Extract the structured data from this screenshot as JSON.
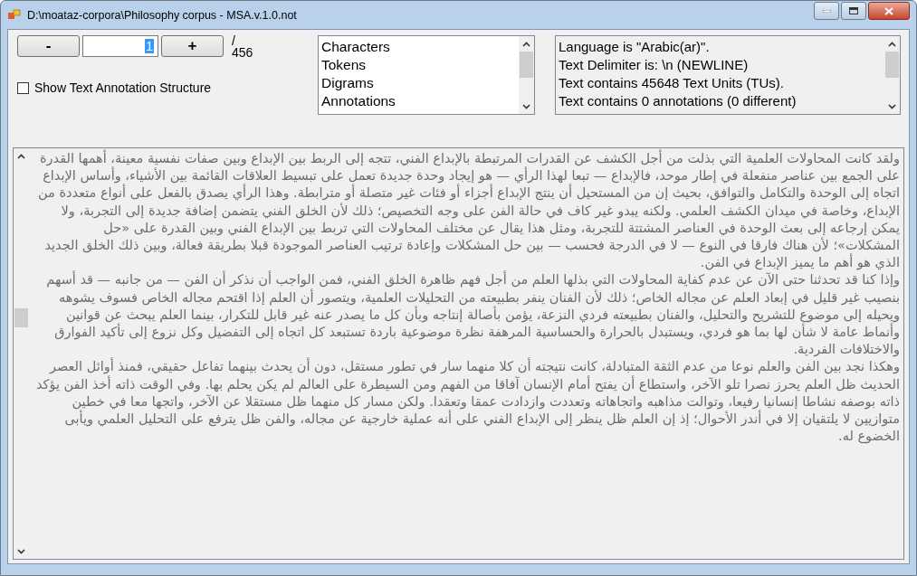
{
  "window": {
    "title": "D:\\moataz-corpora\\Philosophy corpus - MSA.v.1.0.not"
  },
  "navigator": {
    "minus": "-",
    "page": "1",
    "plus": "+",
    "slash": "/",
    "total": "456"
  },
  "annotation_toggle": {
    "label": "Show Text Annotation Structure",
    "checked": false
  },
  "views": [
    {
      "label": "Characters",
      "selected": false
    },
    {
      "label": "Tokens",
      "selected": false
    },
    {
      "label": "Digrams",
      "selected": false
    },
    {
      "label": "Annotations",
      "selected": false
    }
  ],
  "info": [
    "Language is \"Arabic(ar)\".",
    "Text Delimiter is: \\n (NEWLINE)",
    "Text contains 45648 Text Units (TUs).",
    "Text contains 0 annotations (0 different)"
  ],
  "text": {
    "disabled": true,
    "paragraphs": [
      "ولقد كانت المحاولات العلمية التي بذلت من أجل الكشف عن القدرات المرتبطة بالإبداع الفني، تتجه إلى الربط بين الإبداع وبين صفات نفسية معينة، أهمها القدرة على الجمع بين عناصر منفعلة في إطار موحد، فالإبداع — تبعا لهذا الرأي — هو إيجاد وحدة جديدة تعمل على تبسيط العلاقات القائمة بين الأشياء، وأساس الإبداع اتجاه إلى الوحدة والتكامل والتوافق، بحيث إن من المستحيل أن ينتج الإبداع أجزاء أو فئات غير متصلة أو مترابطة. وهذا الرأي يصدق بالفعل على أنواع متعددة من الإبداع، وخاصة في ميدان الكشف العلمي. ولكنه يبدو غير كاف في حالة الفن على وجه التخصيص؛ ذلك لأن الخلق الفني يتضمن إضافة جديدة إلى التجربة، ولا يمكن إرجاعه إلى بعث الوحدة في العناصر المشتتة للتجربة، ومثل هذا يقال عن مختلف المحاولات التي تربط بين الإبداع الفني وبين القدرة على «حل المشكلات»؛ لأن هناك فارقا في النوع — لا في الدرجة فحسب — بين حل المشكلات وإعادة ترتيب العناصر الموجودة قبلا بطريقة فعالة، وبين ذلك الخلق الجديد الذي هو أهم ما يميز الإبداع في الفن.",
      "وإذا كنا قد تحدثنا حتى الآن عن عدم كفاية المحاولات التي بذلها العلم من أجل فهم ظاهرة الخلق الفني، فمن الواجب أن نذكر أن الفن — من جانبه — قد أسهم بنصيب غير قليل في إبعاد العلم عن مجاله الخاص؛ ذلك لأن الفنان ينفر بطبيعته من التحليلات العلمية، ويتصور أن العلم إذا اقتحم مجاله الخاص فسوف يشوهه ويحيله إلى موضوع للتشريح والتحليل، والفنان بطبيعته فردي النزعة، يؤمن بأصالة إنتاجه وبأن كل ما يصدر عنه غير قابل للتكرار، بينما العلم يبحث عن قوانين وأنماط عامة لا شأن لها بما هو فردي، ويستبدل بالحرارة والحساسية المرهفة نظرة موضوعية باردة تستبعد كل اتجاه إلى التفضيل وكل نزوع إلى تأكيد الفوارق والاختلافات الفردية.",
      "وهكذا نجد بين الفن والعلم نوعا من عدم الثقة المتبادلة، كانت نتيجته أن كلا منهما سار في تطور مستقل، دون أن يحدث بينهما تفاعل حقيقي، فمنذ أوائل العصر الحديث ظل العلم يحرز نصرا تلو الآخر، واستطاع أن يفتح أمام الإنسان آفاقا من الفهم ومن السيطرة على العالم لم يكن يحلم بها. وفي الوقت ذاته أخذ الفن يؤكد ذاته بوصفه نشاطا إنسانيا رفيعا، وتوالت مذاهبه واتجاهاته وتعددت وازدادت عمقا وتعقدا. ولكن مسار كل منهما ظل مستقلا عن الآخر، واتجها معا في خطين متوازيين لا يلتقيان إلا في أندر الأحوال؛ إذ إن العلم ظل ينظر إلى الإبداع الفني على أنه عملية خارجية عن مجاله، والفن ظل يترفع على التحليل العلمي ويأبى الخضوع له."
    ]
  }
}
